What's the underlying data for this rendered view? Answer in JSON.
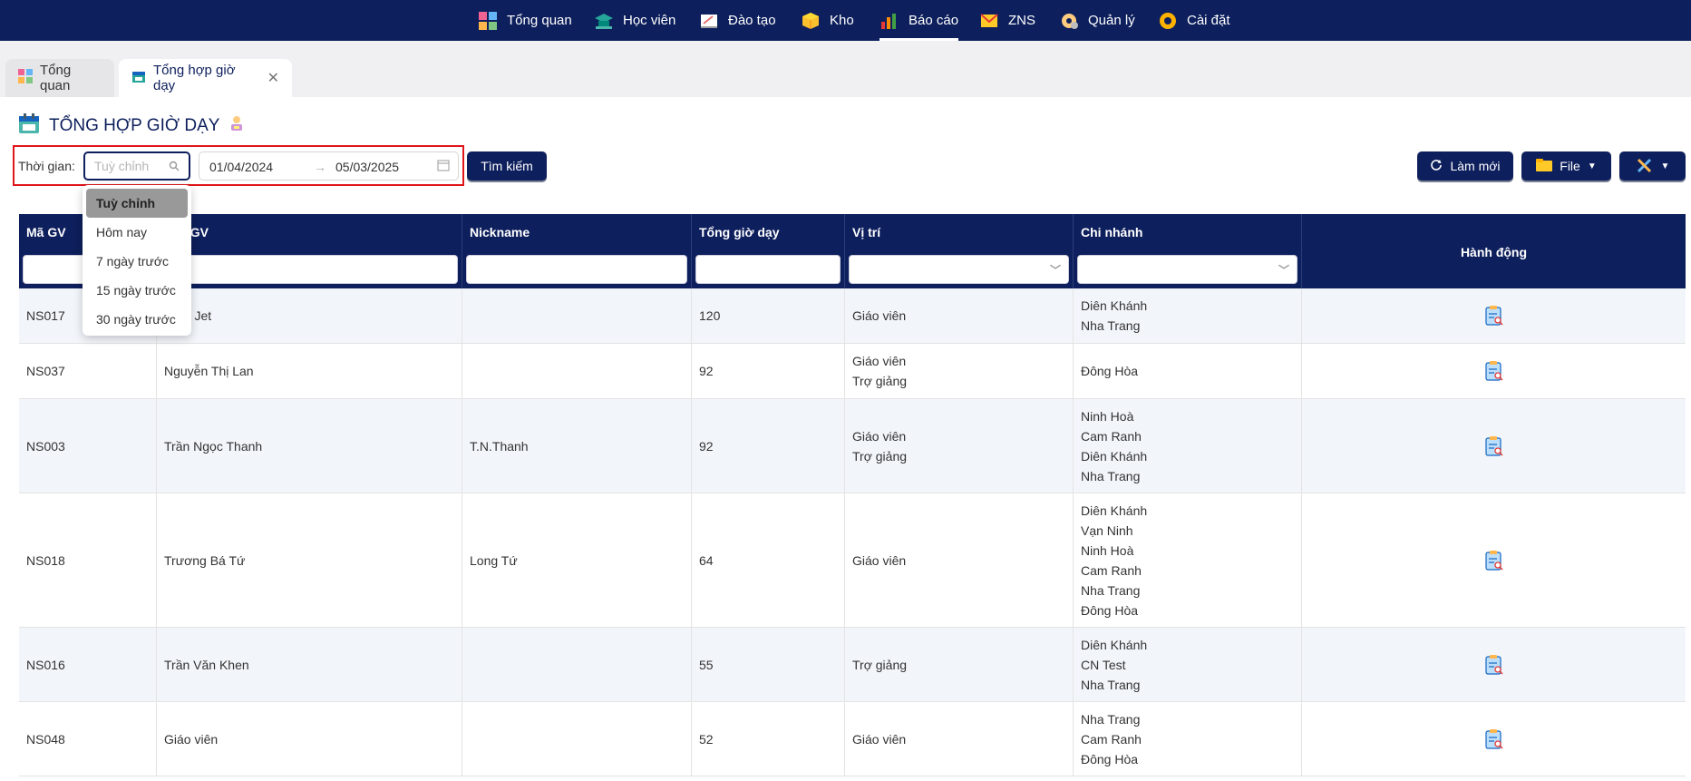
{
  "nav": {
    "items": [
      {
        "label": "Tổng quan",
        "icon": "dashboard-icon"
      },
      {
        "label": "Học viên",
        "icon": "student-cap-icon"
      },
      {
        "label": "Đào tạo",
        "icon": "whiteboard-icon"
      },
      {
        "label": "Kho",
        "icon": "box-icon"
      },
      {
        "label": "Báo cáo",
        "icon": "bar-chart-icon",
        "active": true
      },
      {
        "label": "ZNS",
        "icon": "mail-icon"
      },
      {
        "label": "Quản lý",
        "icon": "manage-gear-icon"
      },
      {
        "label": "Cài đặt",
        "icon": "settings-gear-icon"
      }
    ]
  },
  "tabs": [
    {
      "label": "Tổng quan"
    },
    {
      "label": "Tổng hợp giờ dạy",
      "active": true
    }
  ],
  "page": {
    "title": "TỔNG HỢP GIỜ DẠY"
  },
  "filter": {
    "time_label": "Thời gian:",
    "preset_placeholder": "Tuỳ chỉnh",
    "date_from": "01/04/2024",
    "date_to": "05/03/2025",
    "search_button": "Tìm kiếm",
    "refresh_button": "Làm mới",
    "file_button": "File"
  },
  "dropdown": {
    "options": [
      "Tuỳ chỉnh",
      "Hôm nay",
      "7 ngày trước",
      "15 ngày trước",
      "30 ngày trước"
    ],
    "selected": "Tuỳ chỉnh"
  },
  "table": {
    "headers": {
      "code": "Mã GV",
      "name": "Tên GV",
      "nickname": "Nickname",
      "hours": "Tổng giờ dạy",
      "position": "Vị trí",
      "branch": "Chi nhánh",
      "action": "Hành động"
    },
    "rows": [
      {
        "code": "NS017",
        "name": "Tony Jet",
        "nickname": "",
        "hours": "120",
        "position": [
          "Giáo viên"
        ],
        "branch": [
          "Diên Khánh",
          "Nha Trang"
        ]
      },
      {
        "code": "NS037",
        "name": "Nguyễn Thị Lan",
        "nickname": "",
        "hours": "92",
        "position": [
          "Giáo viên",
          "Trợ giảng"
        ],
        "branch": [
          "Đông Hòa"
        ]
      },
      {
        "code": "NS003",
        "name": "Trần Ngọc Thanh",
        "nickname": "T.N.Thanh",
        "hours": "92",
        "position": [
          "Giáo viên",
          "Trợ giảng"
        ],
        "branch": [
          "Ninh Hoà",
          "Cam Ranh",
          "Diên Khánh",
          "Nha Trang"
        ]
      },
      {
        "code": "NS018",
        "name": "Trương Bá Tứ",
        "nickname": "Long Tứ",
        "hours": "64",
        "position": [
          "Giáo viên"
        ],
        "branch": [
          "Diên Khánh",
          "Vạn Ninh",
          "Ninh Hoà",
          "Cam Ranh",
          "Nha Trang",
          "Đông Hòa"
        ]
      },
      {
        "code": "NS016",
        "name": "Trần Văn Khen",
        "nickname": "",
        "hours": "55",
        "position": [
          "Trợ giảng"
        ],
        "branch": [
          "Diên Khánh",
          "CN Test",
          "Nha Trang"
        ]
      },
      {
        "code": "NS048",
        "name": "Giáo viên",
        "nickname": "",
        "hours": "52",
        "position": [
          "Giáo viên"
        ],
        "branch": [
          "Nha Trang",
          "Cam Ranh",
          "Đông Hòa"
        ]
      }
    ]
  },
  "colors": {
    "primary": "#0d1f5c",
    "highlight_border": "#e0161b"
  }
}
